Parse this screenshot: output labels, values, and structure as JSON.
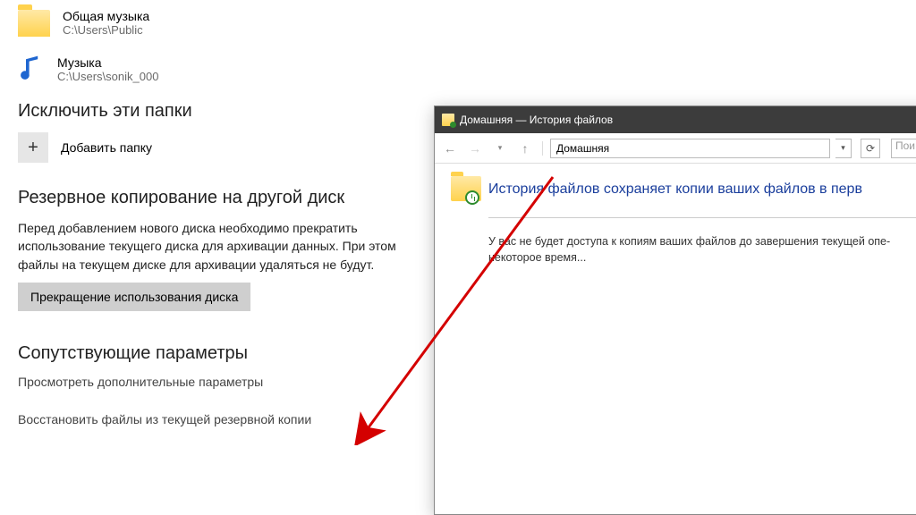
{
  "folders": [
    {
      "title": "Общая музыка",
      "path": "C:\\Users\\Public"
    },
    {
      "title": "Музыка",
      "path": "C:\\Users\\sonik_000"
    }
  ],
  "exclude_heading": "Исключить эти папки",
  "add_folder_label": "Добавить папку",
  "backup_heading": "Резервное копирование на другой диск",
  "backup_body": "Перед добавлением нового диска необходимо прекратить использование текущего диска для архивации данных. При этом файлы на текущем диске для архивации удаляться не будут.",
  "stop_button": "Прекращение использования диска",
  "related_heading": "Сопутствующие параметры",
  "related_link1": "Просмотреть дополнительные параметры",
  "related_link2": "Восстановить файлы из текущей резервной копии",
  "fh_window": {
    "title": "Домашняя — История файлов",
    "address": "Домашняя",
    "search_placeholder": "Пои",
    "headline": "История файлов сохраняет копии ваших файлов в перв",
    "paragraph": "У вас не будет доступа к копиям ваших файлов до завершения текущей опе­некоторое время..."
  }
}
